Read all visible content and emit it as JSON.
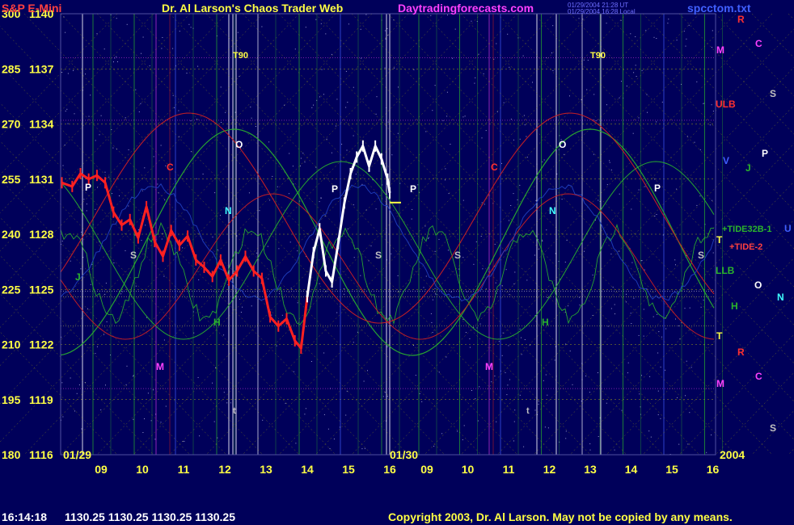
{
  "header": {
    "symbol": "S&P E-Mini",
    "title": "Dr. Al Larson's Chaos Trader Web",
    "site": "Daytradingforecasts.com",
    "stamp_line1": "01/29/2004 21:28 UT",
    "stamp_line2": "01/29/2004 16:28 Local",
    "file": "spcctom.txt"
  },
  "footer": {
    "time": "16:14:18",
    "quotes": "1130.25 1130.25 1130.25 1130.25",
    "copyright": "Copyright 2003, Dr. Al Larson. May not be copied by any means."
  },
  "colors": {
    "background": "#00005a",
    "price_red": "#ff2020",
    "price_white": "#ffffff",
    "flux_green": "#2bb52b",
    "flux_red": "#d02020",
    "grid_yellow": "#c8c800",
    "magenta": "#ff40ff"
  },
  "chart_data": {
    "type": "line",
    "title": "S&P E-Mini",
    "y_left_labels": [
      "300",
      "285",
      "270",
      "255",
      "240",
      "225",
      "210",
      "195",
      "180"
    ],
    "y_right_labels": [
      "1140",
      "1137",
      "1134",
      "1131",
      "1128",
      "1125",
      "1122",
      "1119",
      "1116"
    ],
    "ylim": [
      1116,
      1140
    ],
    "x_tick_labels": [
      "09",
      "10",
      "11",
      "12",
      "13",
      "14",
      "15",
      "16",
      "09",
      "10",
      "11",
      "12",
      "13",
      "14",
      "15",
      "16"
    ],
    "date_labels": [
      "01/29",
      "01/30"
    ],
    "year_label": "2004",
    "series": [
      {
        "color": "#ff2020",
        "x": [
          8.05,
          8.3,
          8.5,
          8.7,
          8.9,
          9.1,
          9.3,
          9.5,
          9.7,
          9.9,
          10.1,
          10.3,
          10.5,
          10.7,
          10.9,
          11.1,
          11.3,
          11.5,
          11.7,
          11.9,
          12.1,
          12.3,
          12.5,
          12.7,
          12.9,
          13.1,
          13.3,
          13.5,
          13.7,
          13.85,
          14.0
        ],
        "y": [
          1130.8,
          1130.6,
          1131.3,
          1131.0,
          1131.2,
          1130.8,
          1129.2,
          1128.5,
          1128.8,
          1127.8,
          1129.5,
          1127.6,
          1126.8,
          1128.2,
          1127.4,
          1127.9,
          1126.6,
          1126.2,
          1125.7,
          1126.6,
          1125.5,
          1126.0,
          1126.8,
          1126.0,
          1125.6,
          1123.5,
          1123.0,
          1123.4,
          1122.2,
          1121.8,
          1124.6
        ]
      },
      {
        "color": "#ffffff",
        "x": [
          14.0,
          14.15,
          14.3,
          14.45,
          14.6,
          14.75,
          14.9,
          15.05,
          15.2,
          15.35,
          15.5,
          15.65,
          15.8,
          15.95,
          16.0
        ],
        "y": [
          1124.6,
          1127.0,
          1128.3,
          1126.0,
          1125.4,
          1127.5,
          1129.7,
          1131.3,
          1132.2,
          1132.8,
          1131.7,
          1132.8,
          1132.1,
          1131.0,
          1130.25
        ]
      }
    ],
    "grid": true
  },
  "labels": {
    "t90": "T90",
    "p": "P",
    "c": "C",
    "o": "O",
    "n": "N",
    "s": "S",
    "j": "J",
    "r": "R",
    "h": "H",
    "m": "M",
    "t": "T",
    "u": "U",
    "v": "V",
    "tsmall": "t",
    "ulb": "ULB",
    "llb": "LLB",
    "tide32b": "+TIDE32B-1",
    "tide2": "+TIDE-2"
  }
}
